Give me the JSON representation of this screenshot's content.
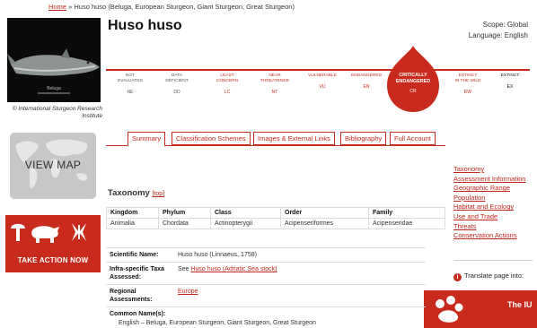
{
  "breadcrumb": {
    "home": "Home",
    "separator": "»",
    "current": "Huso huso (Beluga, European Sturgeon, Giant Sturgeon, Great Sturgeon)"
  },
  "photo": {
    "caption": "© International Sturgeon Research Institute",
    "inner_caption": "Beluga"
  },
  "species_title": "Huso huso",
  "scope": {
    "scope_line": "Scope: Global",
    "language_line": "Language: English"
  },
  "categories": [
    {
      "label": "NOT\nEVALUATED",
      "code": "NE"
    },
    {
      "label": "DATA\nDEFICIENT",
      "code": "DD"
    },
    {
      "label": "LEAST\nCONCERN",
      "code": "LC"
    },
    {
      "label": "NEAR\nTHREATENED",
      "code": "NT"
    },
    {
      "label": "VULNERABLE",
      "code": "VU"
    },
    {
      "label": "ENDANGERED",
      "code": "EN"
    },
    {
      "label": "CRITICALLY\nENDANGERED",
      "code": "CR"
    },
    {
      "label": "EXTINCT\nIN THE WILD",
      "code": "EW"
    },
    {
      "label": "EXTINCT",
      "code": "EX"
    }
  ],
  "left_panel": {
    "view_map": "VIEW MAP",
    "take_action": "TAKE ACTION NOW"
  },
  "tabs": [
    {
      "label": "Summary",
      "active": true
    },
    {
      "label": "Classification Schemes",
      "active": false
    },
    {
      "label": "Images & External Links",
      "active": false
    },
    {
      "label": "Bibliography",
      "active": false
    },
    {
      "label": "Full Account",
      "active": false
    }
  ],
  "side_links": [
    "Taxonomy",
    "Assessment Information",
    "Geographic Range",
    "Population",
    "Habitat and Ecology",
    "Use and Trade",
    "Threats",
    "Conservation Actions"
  ],
  "translate_label": "Translate page into:",
  "iucn_banner_text": "The IU",
  "taxonomy": {
    "heading": "Taxonomy",
    "top_link": "[top]",
    "headers": [
      "Kingdom",
      "Phylum",
      "Class",
      "Order",
      "Family"
    ],
    "values": [
      "Animalia",
      "Chordata",
      "Actinopterygii",
      "Acipenseriformes",
      "Acipenseridae"
    ]
  },
  "details": {
    "scientific_name_label": "Scientific Name:",
    "scientific_name": "Huso huso (Linnaeus, 1758)",
    "infra_label": "Infra-specific Taxa Assessed:",
    "infra_prefix": "See",
    "infra_link": "Huso huso (Adriatic Sea stock)",
    "regional_label": "Regional Assessments:",
    "regional_link": "Europe",
    "common_label": "Common Name(s):",
    "common_value": "English – Beluga, European Sturgeon, Giant Sturgeon, Great Sturgeon"
  },
  "colors": {
    "iucn_red": "#c82a1d"
  }
}
